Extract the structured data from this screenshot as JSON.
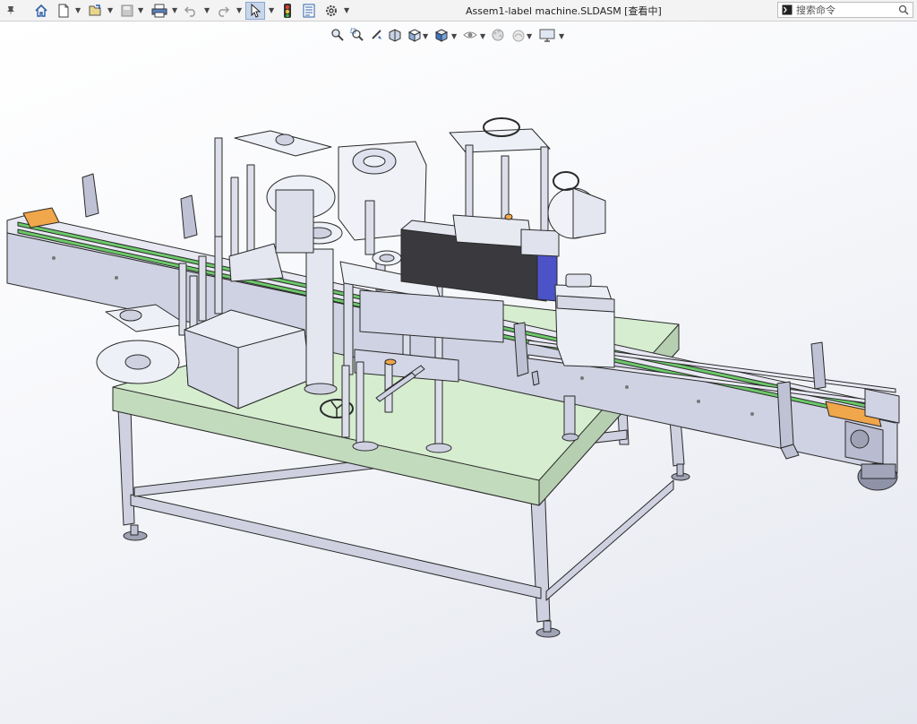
{
  "app": {
    "window_title": "Assem1-label machine.SLDASM [查看中]"
  },
  "search": {
    "placeholder": "搜索命令"
  },
  "toolbar": {
    "buttons": [
      "pin-icon",
      "home-icon",
      "new-document-icon",
      "open-icon",
      "save-icon",
      "print-icon",
      "undo-icon",
      "redo-icon",
      "select-icon",
      "rebuild-icon",
      "file-properties-icon",
      "options-icon"
    ]
  },
  "heads_up_toolbar": {
    "buttons": [
      "zoom-to-fit-icon",
      "zoom-to-area-icon",
      "previous-view-icon",
      "section-view-icon",
      "view-orientation-icon",
      "display-style-icon",
      "hide-show-items-icon",
      "edit-appearance-icon",
      "apply-scene-icon",
      "view-settings-icon"
    ]
  },
  "colors": {
    "tabletop": "#d6edd0",
    "frame": "#cfd1e0",
    "edge": "#2a2a2a",
    "belt_green": "#6cc96a",
    "accent_orange": "#f0a64a",
    "motor_blue": "#4c52c8"
  }
}
